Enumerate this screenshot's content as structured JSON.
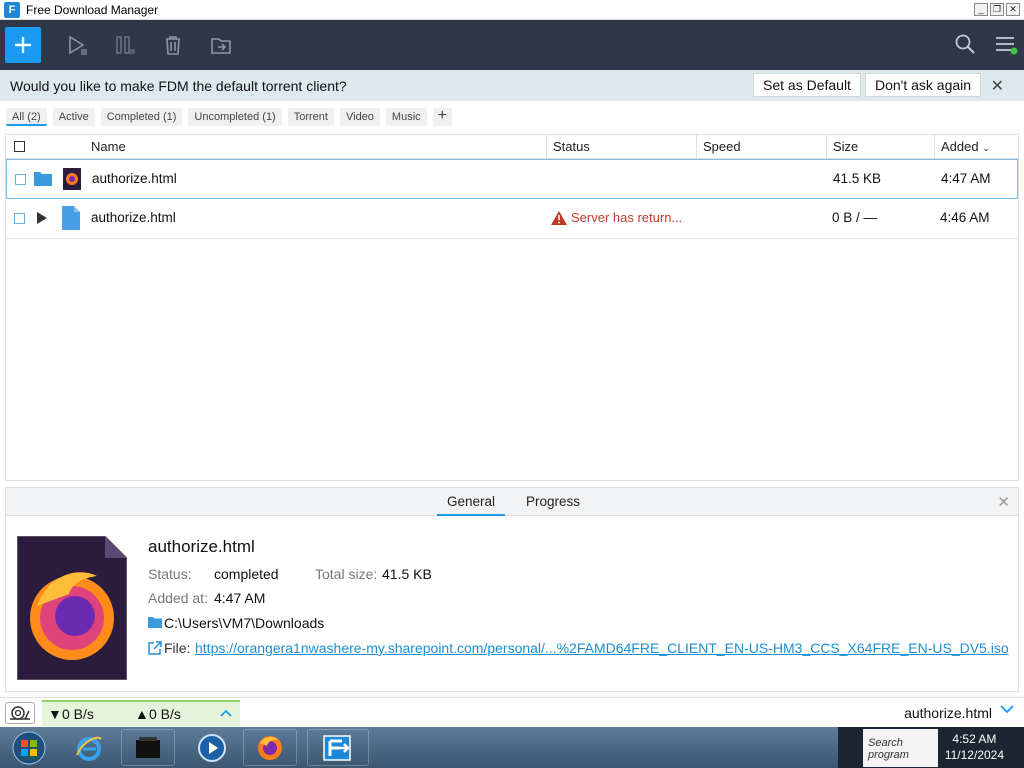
{
  "window": {
    "title": "Free Download Manager"
  },
  "banner": {
    "message": "Would you like to make FDM the default torrent client?",
    "set_default": "Set as Default",
    "dont_ask": "Don't ask again"
  },
  "filters": [
    "All (2)",
    "Active",
    "Completed (1)",
    "Uncompleted (1)",
    "Torrent",
    "Video",
    "Music"
  ],
  "table": {
    "headers": {
      "name": "Name",
      "status": "Status",
      "speed": "Speed",
      "size": "Size",
      "added": "Added"
    },
    "rows": [
      {
        "name": "authorize.html",
        "status": "",
        "speed": "",
        "size": "41.5 KB",
        "added": "4:47 AM"
      },
      {
        "name": "authorize.html",
        "status": "Server has return...",
        "speed": "",
        "size": "0 B / —",
        "added": "4:46 AM"
      }
    ]
  },
  "details": {
    "tabs": {
      "general": "General",
      "progress": "Progress"
    },
    "filename": "authorize.html",
    "status_label": "Status:",
    "status_value": "completed",
    "total_size_label": "Total size:",
    "total_size_value": "41.5 KB",
    "added_label": "Added at:",
    "added_value": "4:47 AM",
    "folder": "C:\\Users\\VM7\\Downloads",
    "file_label": "File:",
    "file_url": "https://orangera1nwashere-my.sharepoint.com/personal/...%2FAMD64FRE_CLIENT_EN-US-HM3_CCS_X64FRE_EN-US_DV5.iso"
  },
  "statusbar": {
    "download_speed": "0 B/s",
    "upload_speed": "0 B/s",
    "current_file": "authorize.html"
  },
  "taskbar": {
    "search_text": "Search program",
    "time": "4:52 AM",
    "date": "11/12/2024"
  },
  "colors": {
    "accent": "#1a9af0",
    "toolbar": "#2f3848",
    "banner": "#dde9ec",
    "error": "#c0392b"
  }
}
